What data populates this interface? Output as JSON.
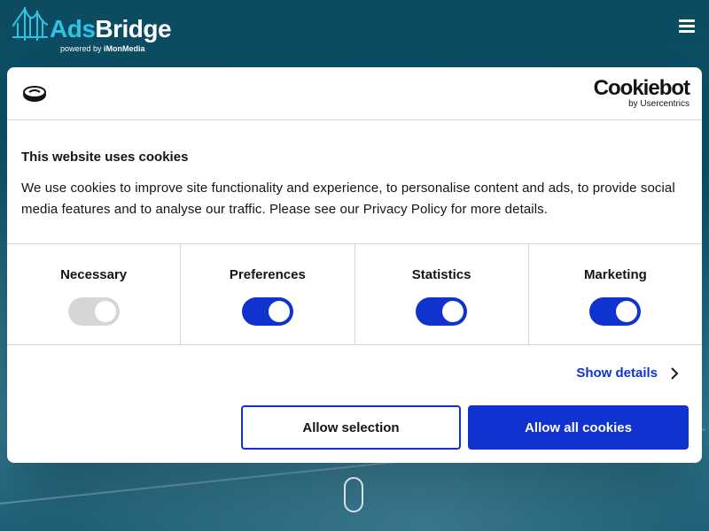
{
  "header": {
    "logo_part1": "Ads",
    "logo_part2": "Bridge",
    "powered_by": "powered by",
    "powered_brand": "iMonMedia",
    "menu_icon": "hamburger-icon"
  },
  "dialog": {
    "cookie_icon": "cookie-icon",
    "brand_name": "Cookiebot",
    "brand_sub": "by Usercentrics",
    "title": "This website uses cookies",
    "text": "We use cookies to improve site functionality and experience, to personalise content and ads, to provide social media features and to analyse our traffic. Please see our Privacy Policy for more details.",
    "categories": [
      {
        "label": "Necessary",
        "enabled": true,
        "disabled": true
      },
      {
        "label": "Preferences",
        "enabled": true,
        "disabled": false
      },
      {
        "label": "Statistics",
        "enabled": true,
        "disabled": false
      },
      {
        "label": "Marketing",
        "enabled": true,
        "disabled": false
      }
    ],
    "show_details": "Show details",
    "btn_selection": "Allow selection",
    "btn_allow_all": "Allow all cookies",
    "colors": {
      "accent": "#1032cf",
      "text": "#141414",
      "divider": "#d6d6d6"
    }
  }
}
